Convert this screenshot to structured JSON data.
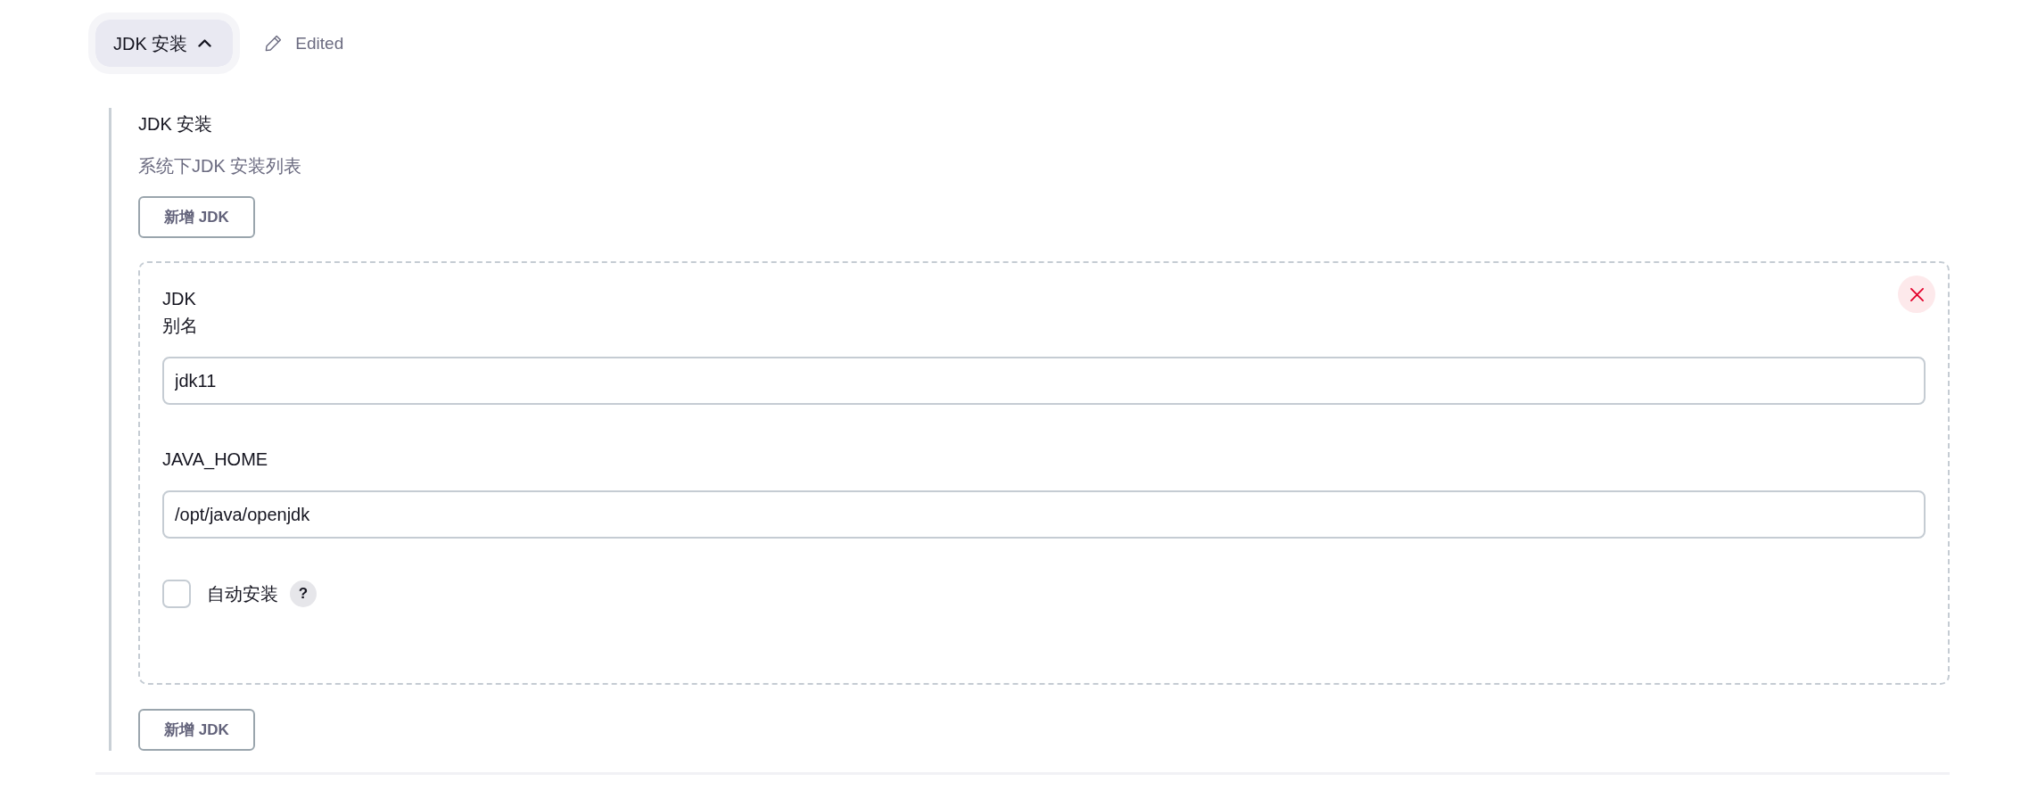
{
  "header": {
    "section_toggle": {
      "label": "JDK 安装",
      "expanded": true
    },
    "status": "Edited"
  },
  "section": {
    "title": "JDK 安装",
    "description": "系统下JDK 安装列表",
    "add_button_top": "新增 JDK",
    "installations": [
      {
        "heading": "JDK",
        "fields": [
          {
            "label": "别名",
            "value": "jdk11"
          },
          {
            "label": "JAVA_HOME",
            "value": "/opt/java/openjdk"
          }
        ],
        "auto_install": {
          "label": "自动安装",
          "checked": false,
          "help": "?"
        }
      }
    ],
    "add_button_bottom": "新增 JDK"
  }
}
